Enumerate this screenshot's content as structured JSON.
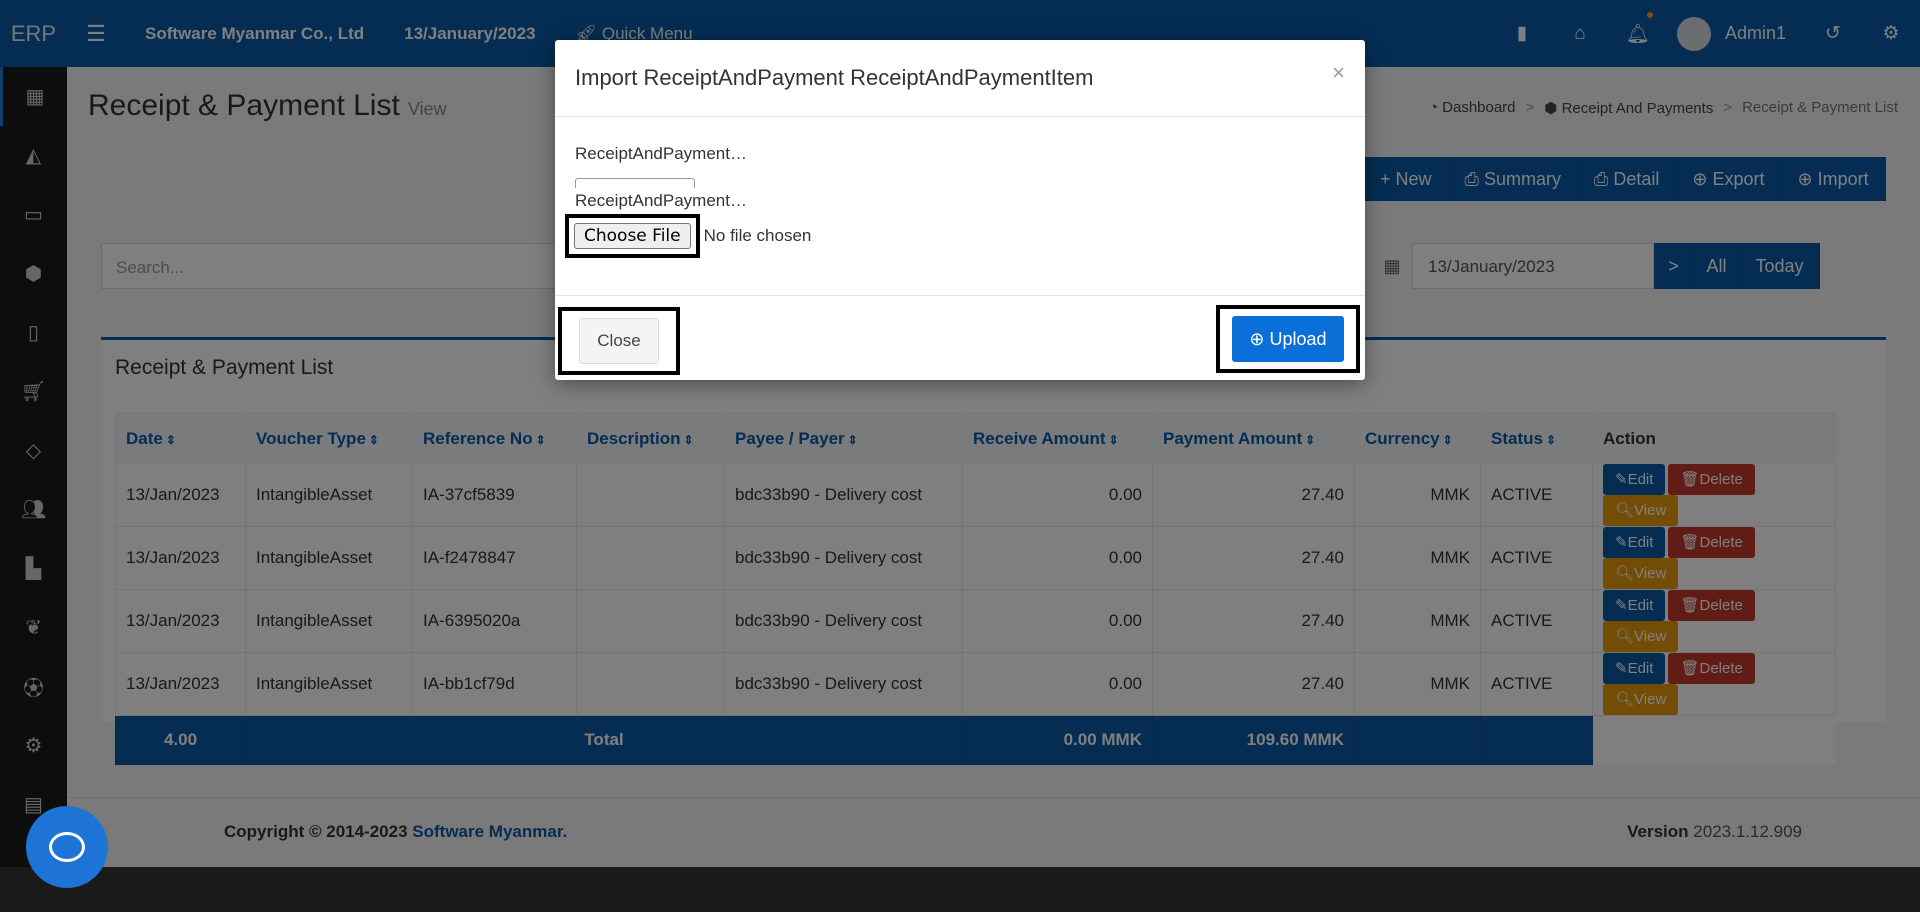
{
  "topbar": {
    "brand": "ERP",
    "company": "Software Myanmar Co., Ltd",
    "date": "13/January/2023",
    "quick_menu": "Quick Menu",
    "user": "Admin1",
    "icons": [
      "menu-icon",
      "rocket-icon",
      "building-icon",
      "home-icon",
      "bell-icon",
      "history-icon",
      "gear-icon"
    ]
  },
  "sidebar": {
    "icons": [
      "calculator-icon",
      "area-chart-icon",
      "credit-card-icon",
      "cube-icon",
      "clipboard-icon",
      "cart-icon",
      "diamond-icon",
      "users-icon",
      "bar-chart-icon",
      "leaf-icon",
      "soccer-ball-icon",
      "cog-icon",
      "book-icon",
      "chat-icon"
    ]
  },
  "page": {
    "title": "Receipt & Payment List",
    "subtitle": "View"
  },
  "breadcrumb": {
    "dashboard": "Dashboard",
    "parent": "Receipt And Payments",
    "current": "Receipt & Payment List",
    "sep": ">"
  },
  "actions": {
    "new": "New",
    "summary": "Summary",
    "detail": "Detail",
    "export": "Export",
    "import": "Import"
  },
  "filters": {
    "search_placeholder": "Search...",
    "date": "13/January/2023",
    "next": ">",
    "all": "All",
    "today": "Today"
  },
  "panel": {
    "title": "Receipt & Payment List"
  },
  "table": {
    "headers": [
      "Date",
      "Voucher Type",
      "Reference No",
      "Description",
      "Payee / Payer",
      "Receive Amount",
      "Payment Amount",
      "Currency",
      "Status",
      "Action"
    ],
    "rows": [
      [
        "13/Jan/2023",
        "IntangibleAsset",
        "IA-37cf5839",
        "",
        "bdc33b90 - Delivery cost",
        "0.00",
        "27.40",
        "MMK",
        "ACTIVE"
      ],
      [
        "13/Jan/2023",
        "IntangibleAsset",
        "IA-f2478847",
        "",
        "bdc33b90 - Delivery cost",
        "0.00",
        "27.40",
        "MMK",
        "ACTIVE"
      ],
      [
        "13/Jan/2023",
        "IntangibleAsset",
        "IA-6395020a",
        "",
        "bdc33b90 - Delivery cost",
        "0.00",
        "27.40",
        "MMK",
        "ACTIVE"
      ],
      [
        "13/Jan/2023",
        "IntangibleAsset",
        "IA-bb1cf79d",
        "",
        "bdc33b90 - Delivery cost",
        "0.00",
        "27.40",
        "MMK",
        "ACTIVE"
      ]
    ],
    "row_buttons": {
      "edit": "Edit",
      "delete": "Delete",
      "view": "View"
    },
    "total": {
      "count": "4.00",
      "label": "Total",
      "receive": "0.00 MMK",
      "payment": "109.60 MMK"
    }
  },
  "footer": {
    "copyright": "Copyright © 2014-2023",
    "company_link": "Software Myanmar.",
    "version_label": "Version",
    "version": "2023.1.12.909"
  },
  "modal": {
    "title": "Import ReceiptAndPayment ReceiptAndPaymentItem",
    "field1_label": "ReceiptAndPayment…",
    "field2_label": "ReceiptAndPayment…",
    "choose_file": "Choose File",
    "no_file": "No file chosen",
    "close": "Close",
    "upload": "Upload",
    "close_x": "×"
  },
  "colors": {
    "primary": "#0b5aa8",
    "danger": "#c0392b",
    "warning": "#e69b0c",
    "sidebar": "#1b1b1b"
  }
}
